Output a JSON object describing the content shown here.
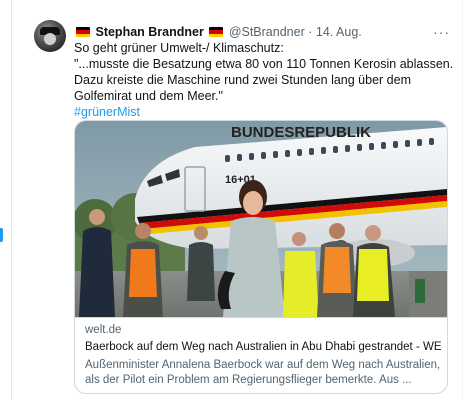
{
  "tweet": {
    "name": "Stephan Brandner",
    "handle": "@StBrandner",
    "separator": "·",
    "date": "14. Aug.",
    "more_icon": "···",
    "lines": [
      "So geht grüner Umwelt-/ Klimaschutz:",
      "\"...musste die Besatzung etwa 80 von 110 Tonnen Kerosin ablassen. Dazu kreiste die Maschine rund zwei Stunden lang über dem Golfemirat und dem Meer.\""
    ],
    "hashtag": "#grünerMist"
  },
  "card": {
    "aircraft_lettering": "BUNDESREPUBLIK",
    "aircraft_number": "16+01",
    "domain": "welt.de",
    "title": "Baerbock auf dem Weg nach Australien in Abu Dhabi gestrandet - WE...",
    "description": "Außenminister Annalena Baerbock war auf dem Weg nach Australien, als der Pilot ein Problem am Regierungsflieger bemerkte. Aus ..."
  },
  "colors": {
    "accent": "#1d9bf0",
    "text": "#0f1419",
    "muted": "#536471",
    "flag_black": "#000000",
    "flag_red": "#dd0000",
    "flag_gold": "#ffce00"
  }
}
